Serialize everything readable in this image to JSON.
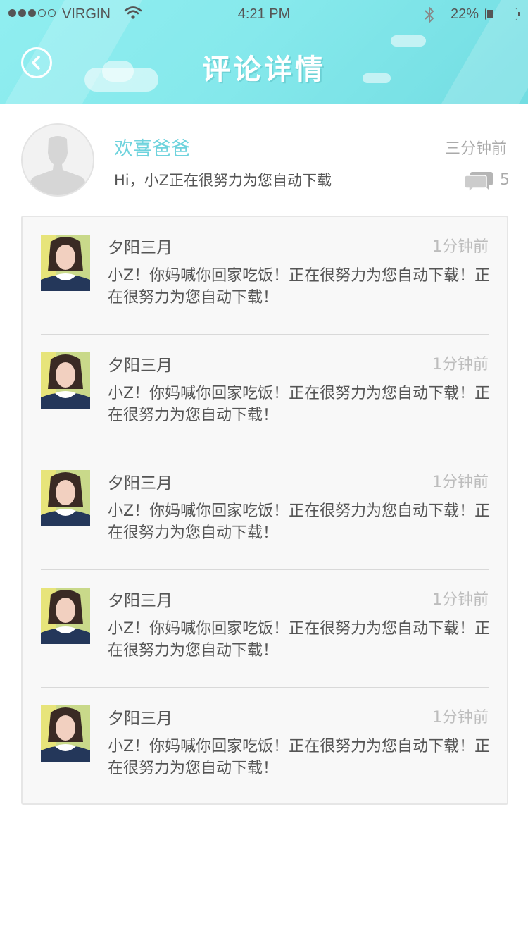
{
  "status_bar": {
    "carrier": "VIRGIN",
    "time": "4:21 PM",
    "battery": "22%"
  },
  "header": {
    "title": "评论详情"
  },
  "post": {
    "author": "欢喜爸爸",
    "time": "三分钟前",
    "text": "Hi，小Z正在很努力为您自动下载",
    "comment_count": "5"
  },
  "comments": [
    {
      "name": "夕阳三月",
      "time": "1分钟前",
      "text": "小Z！你妈喊你回家吃饭！正在很努力为您自动下载！正在很努力为您自动下载！"
    },
    {
      "name": "夕阳三月",
      "time": "1分钟前",
      "text": "小Z！你妈喊你回家吃饭！正在很努力为您自动下载！正在很努力为您自动下载！"
    },
    {
      "name": "夕阳三月",
      "time": "1分钟前",
      "text": "小Z！你妈喊你回家吃饭！正在很努力为您自动下载！正在很努力为您自动下载！"
    },
    {
      "name": "夕阳三月",
      "time": "1分钟前",
      "text": "小Z！你妈喊你回家吃饭！正在很努力为您自动下载！正在很努力为您自动下载！"
    },
    {
      "name": "夕阳三月",
      "time": "1分钟前",
      "text": "小Z！你妈喊你回家吃饭！正在很努力为您自动下载！正在很努力为您自动下载！"
    }
  ],
  "colors": {
    "header_accent": "#86e9ec",
    "author_name": "#6fd3dd"
  },
  "icons": [
    "back-icon",
    "comment-bubble-icon",
    "wifi-icon",
    "bluetooth-icon",
    "battery-icon"
  ]
}
